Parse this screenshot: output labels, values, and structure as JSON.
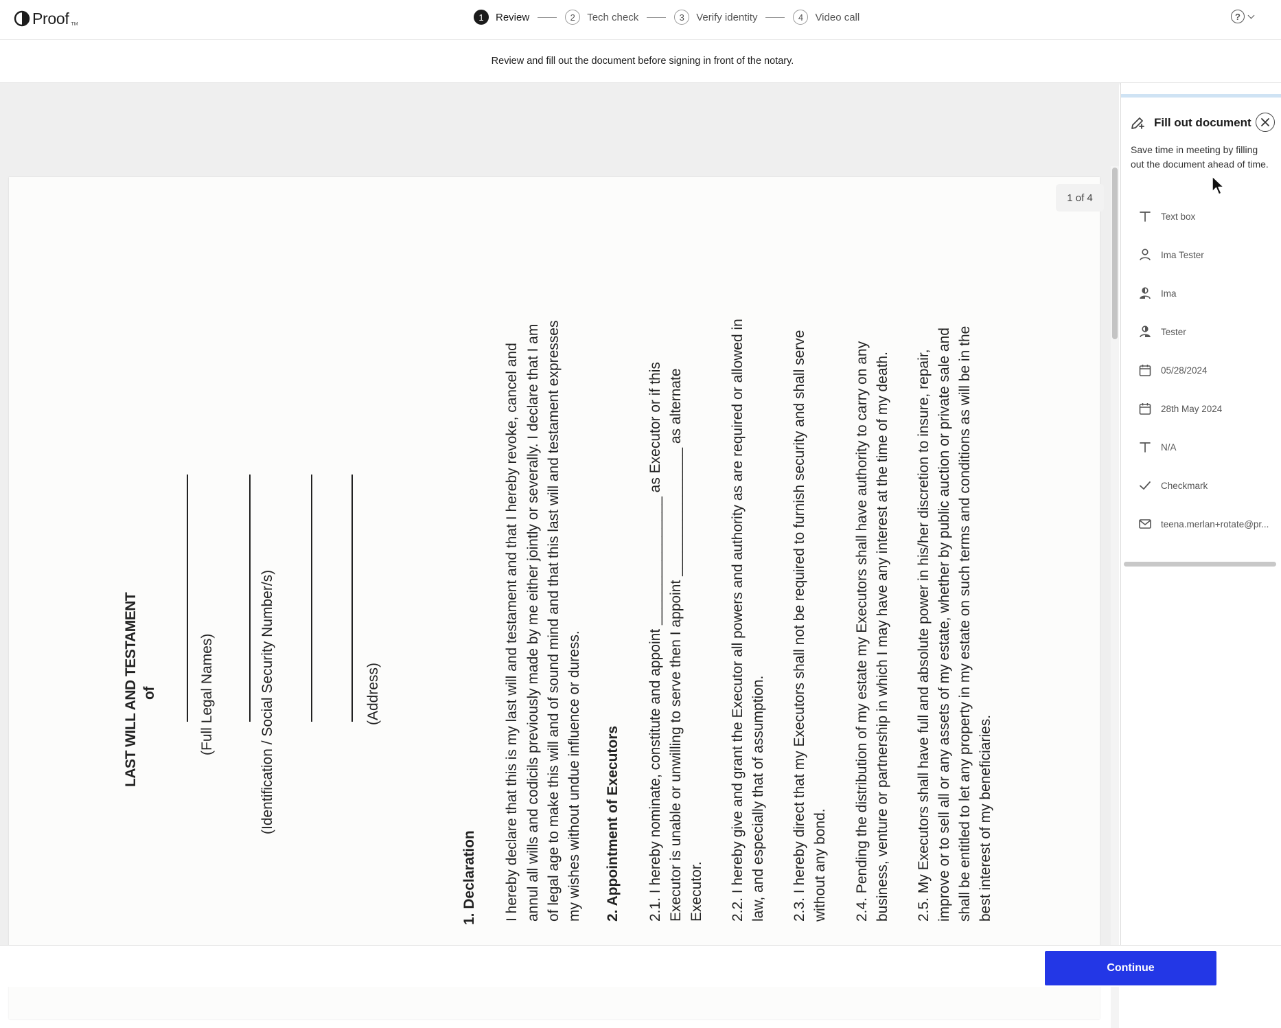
{
  "app": {
    "name": "Proof"
  },
  "stepper": {
    "steps": [
      {
        "number": "1",
        "label": "Review",
        "active": true
      },
      {
        "number": "2",
        "label": "Tech check",
        "active": false
      },
      {
        "number": "3",
        "label": "Verify identity",
        "active": false
      },
      {
        "number": "4",
        "label": "Video call",
        "active": false
      }
    ]
  },
  "help": {
    "icon": "help-circle-icon",
    "glyph": "?"
  },
  "instruction": "Review and fill out the document before signing in front of the notary.",
  "document": {
    "page_indicator": "1 of 4",
    "title_line1": "LAST WILL AND TESTAMENT",
    "title_line2": "of",
    "field_labels": {
      "names": "(Full Legal Names)",
      "identification": "(Identification / Social Security Number/s)",
      "address": "(Address)"
    },
    "section1": {
      "heading": "1. Declaration",
      "lines": [
        "I hereby declare that this is my last will and testament and that I hereby revoke, cancel and",
        "annul all wills and codicils previously made by me either jointly or severally. I declare that I am",
        "of legal age to make this will and of sound mind and that this last will and testament expresses",
        "my wishes without undue influence or duress."
      ]
    },
    "section2": {
      "heading": "2. Appointment of Executors",
      "p1": [
        "2.1. I hereby nominate, constitute and appoint ________________ as Executor or if this",
        "Executor is unable or unwilling to serve then I appoint ________________ as alternate",
        "Executor."
      ],
      "p2": [
        "2.2. I hereby give and grant the Executor all powers and authority as are required or allowed in",
        "law, and especially that of assumption."
      ],
      "p3": [
        "2.3. I hereby direct that my Executors shall not be required to furnish security and shall serve",
        "without any bond."
      ],
      "p4": [
        "2.4. Pending the distribution of my estate my Executors shall have authority to carry on any",
        "business, venture or partnership in which I may have any interest at the time of my death."
      ],
      "p5": [
        "2.5. My Executors shall have full and absolute power in his/her discretion to insure, repair,",
        "improve or to sell all or any assets of my estate, whether by public auction or private sale and",
        "shall be entitled to let any property in my estate on such terms and conditions as will be in the",
        "best interest of my beneficiaries."
      ]
    }
  },
  "panel": {
    "title": "Fill out document",
    "title_icon": "pen-plus-icon",
    "close_icon": "close-icon",
    "description": "Save time in meeting by filling out the document ahead of time.",
    "items": [
      {
        "icon": "text-icon",
        "label": "Text box"
      },
      {
        "icon": "person-icon",
        "label": "Ima Tester"
      },
      {
        "icon": "person-first-icon",
        "label": "Ima"
      },
      {
        "icon": "person-last-icon",
        "label": "Tester"
      },
      {
        "icon": "calendar-icon",
        "label": "05/28/2024"
      },
      {
        "icon": "calendar-icon",
        "label": "28th May 2024"
      },
      {
        "icon": "text-icon",
        "label": "N/A"
      },
      {
        "icon": "checkmark-icon",
        "label": "Checkmark"
      },
      {
        "icon": "email-icon",
        "label": "teena.merlan+rotate@pr..."
      }
    ]
  },
  "footer": {
    "continue_label": "Continue"
  },
  "colors": {
    "primary": "#2337e6",
    "panel_strip": "#cfe3f4"
  }
}
